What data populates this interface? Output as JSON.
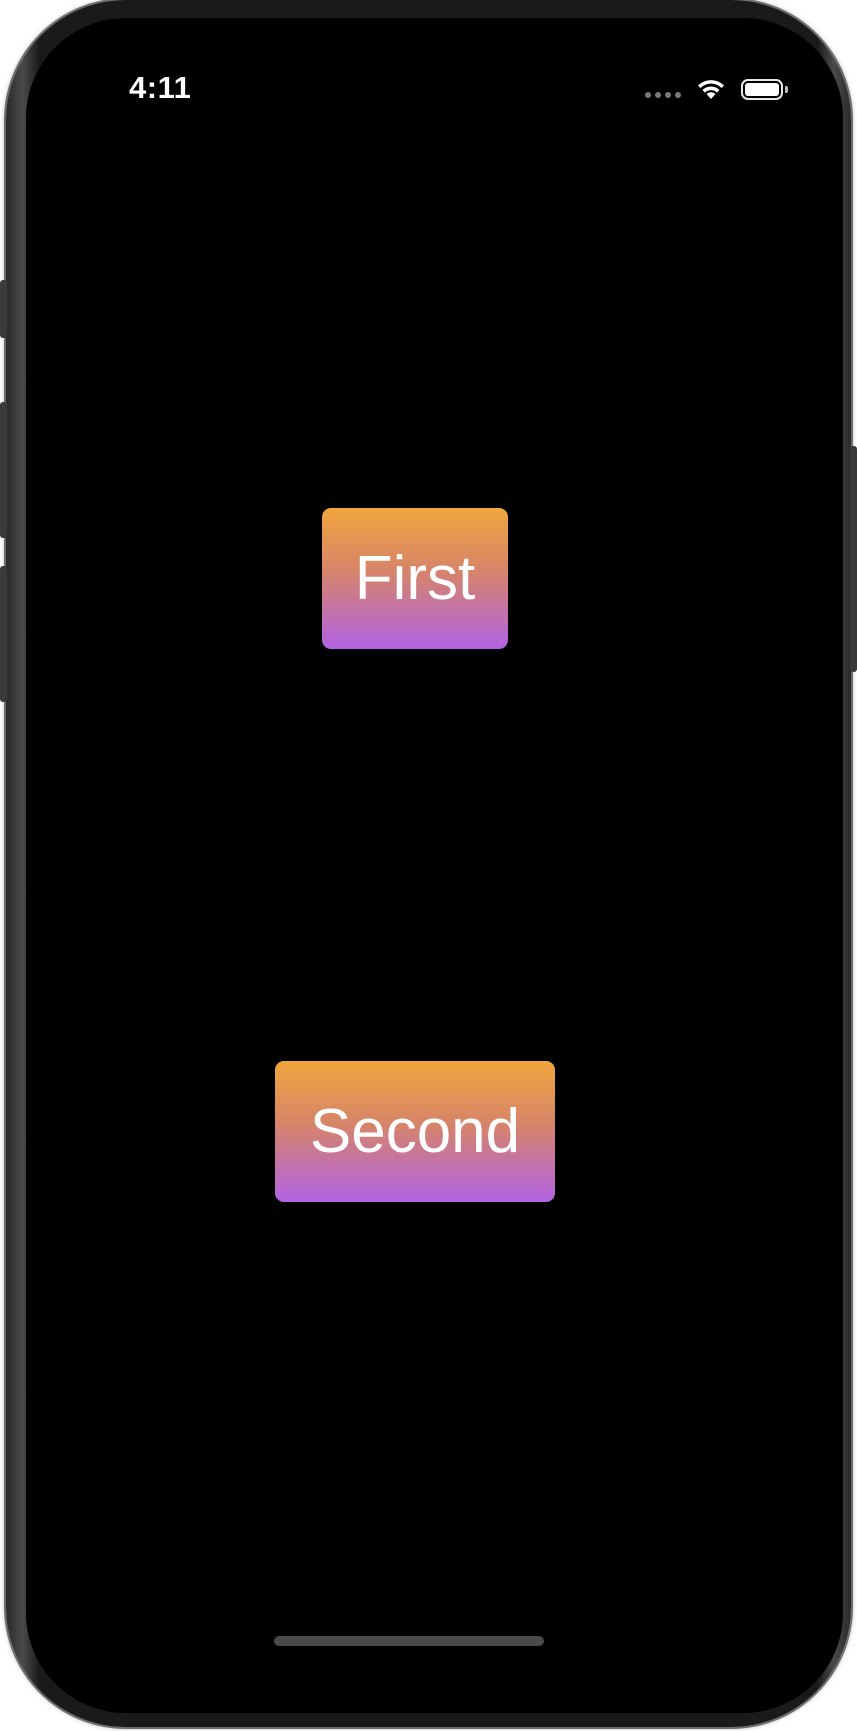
{
  "status_bar": {
    "time": "4:11",
    "signal_icon": "signal-dots-icon",
    "wifi_icon": "wifi-icon",
    "battery_icon": "battery-icon"
  },
  "main": {
    "first_button_label": "First",
    "second_button_label": "Second"
  },
  "colors": {
    "background": "#000000",
    "button_gradient_top": "#f1a63c",
    "button_gradient_bottom": "#b163e4",
    "button_text": "#ffffff"
  }
}
